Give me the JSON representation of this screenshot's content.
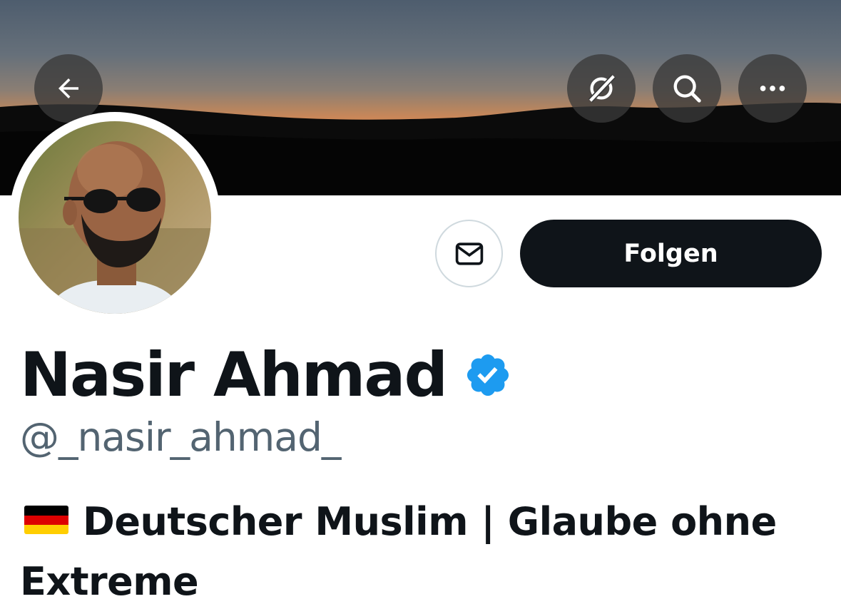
{
  "header": {
    "back_icon": "arrow-left-icon",
    "grok_icon": "grok-icon",
    "search_icon": "search-icon",
    "more_icon": "more-horizontal-icon"
  },
  "profile": {
    "display_name": "Nasir Ahmad",
    "verified": true,
    "verified_color": "#1d9bf0",
    "handle": "@_nasir_ahmad_",
    "bio_flag": "flag-germany",
    "bio_text": "Deutscher Muslim | Glaube ohne Extreme"
  },
  "actions": {
    "message_icon": "envelope-icon",
    "follow_label": "Folgen"
  }
}
